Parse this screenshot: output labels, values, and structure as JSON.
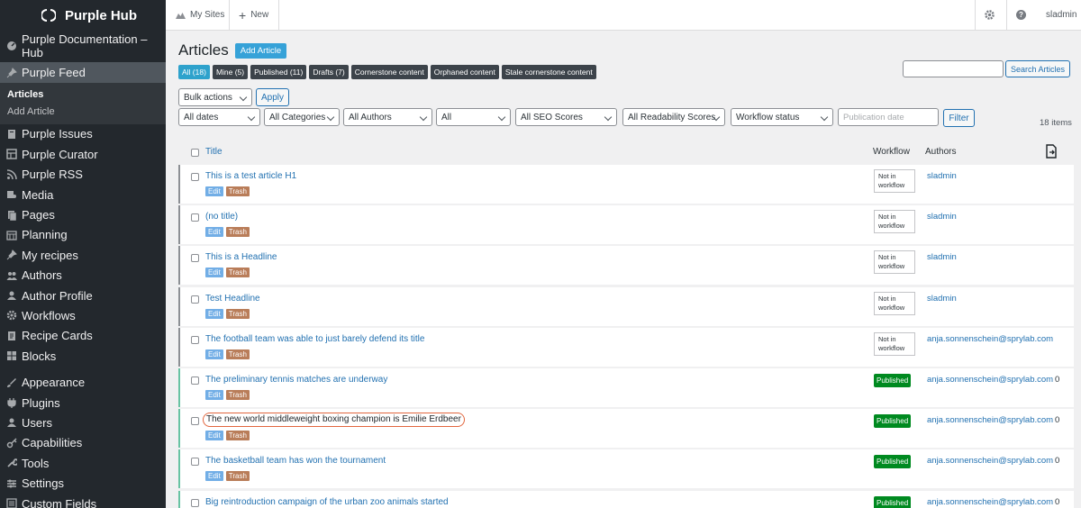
{
  "brand": {
    "name": "Purple Hub"
  },
  "sidebar": {
    "items": [
      {
        "label": "Purple Documentation – Hub",
        "icon": "dashboard-icon"
      },
      {
        "label": "Purple Feed",
        "icon": "pin-icon",
        "current": true
      },
      {
        "label": "Purple Issues",
        "icon": "issues-icon"
      },
      {
        "label": "Purple Curator",
        "icon": "curator-icon"
      },
      {
        "label": "Purple RSS",
        "icon": "rss-icon"
      },
      {
        "label": "Media",
        "icon": "media-icon"
      },
      {
        "label": "Pages",
        "icon": "pages-icon"
      },
      {
        "label": "Planning",
        "icon": "calendar-icon"
      },
      {
        "label": "My recipes",
        "icon": "pin-icon"
      },
      {
        "label": "Authors",
        "icon": "users-icon"
      },
      {
        "label": "Author Profile",
        "icon": "user-icon"
      },
      {
        "label": "Workflows",
        "icon": "gear-icon"
      },
      {
        "label": "Recipe Cards",
        "icon": "cards-icon"
      },
      {
        "label": "Blocks",
        "icon": "blocks-icon"
      },
      {
        "label": "Appearance",
        "icon": "brush-icon"
      },
      {
        "label": "Plugins",
        "icon": "plugin-icon"
      },
      {
        "label": "Users",
        "icon": "user-icon"
      },
      {
        "label": "Capabilities",
        "icon": "key-icon"
      },
      {
        "label": "Tools",
        "icon": "wrench-icon"
      },
      {
        "label": "Settings",
        "icon": "settings-icon"
      },
      {
        "label": "Custom Fields",
        "icon": "fields-icon"
      }
    ],
    "submenu": [
      {
        "label": "Articles",
        "active": true
      },
      {
        "label": "Add Article",
        "active": false
      }
    ]
  },
  "topbar": {
    "my_sites": "My Sites",
    "new": "New",
    "user": "sladmin"
  },
  "page": {
    "title": "Articles",
    "add_button": "Add Article",
    "filters": [
      "All (18)",
      "Mine (5)",
      "Published (11)",
      "Drafts (7)",
      "Cornerstone content",
      "Orphaned content",
      "Stale cornerstone content"
    ],
    "search_button": "Search Articles",
    "bulk_actions": "Bulk actions",
    "apply": "Apply",
    "dates": "All dates",
    "categories": "All Categories",
    "authors": "All Authors",
    "all": "All",
    "seo": "All SEO Scores",
    "readability": "All Readability Scores",
    "workflow_status": "Workflow status",
    "publication_placeholder": "Publication date",
    "filter_button": "Filter",
    "items_count": "18 items"
  },
  "table": {
    "headers": {
      "title": "Title",
      "workflow": "Workflow",
      "authors": "Authors"
    },
    "edit_label": "Edit",
    "trash_label": "Trash",
    "not_in_workflow": "Not in workflow",
    "published_label": "Published",
    "rows": [
      {
        "title": "This is a test article H1",
        "status": "not",
        "author": "sladmin",
        "count": ""
      },
      {
        "title": "(no title)",
        "status": "not",
        "author": "sladmin",
        "count": ""
      },
      {
        "title": "This is a Headline",
        "status": "not",
        "author": "sladmin",
        "count": ""
      },
      {
        "title": "Test Headline",
        "status": "not",
        "author": "sladmin",
        "count": ""
      },
      {
        "title": "The football team was able to just barely defend its title",
        "status": "not",
        "author": "anja.sonnenschein@sprylab.com",
        "count": ""
      },
      {
        "title": "The preliminary tennis matches are underway",
        "status": "published",
        "author": "anja.sonnenschein@sprylab.com",
        "count": "0"
      },
      {
        "title": "The new world middleweight boxing champion is Emilie Erdbeer",
        "status": "published",
        "author": "anja.sonnenschein@sprylab.com",
        "count": "0",
        "highlight": true
      },
      {
        "title": "The basketball team has won the tournament",
        "status": "published",
        "author": "anja.sonnenschein@sprylab.com",
        "count": "0"
      },
      {
        "title": "Big reintroduction campaign of the urban zoo animals started",
        "status": "published",
        "author": "anja.sonnenschein@sprylab.com",
        "count": "0"
      }
    ]
  }
}
